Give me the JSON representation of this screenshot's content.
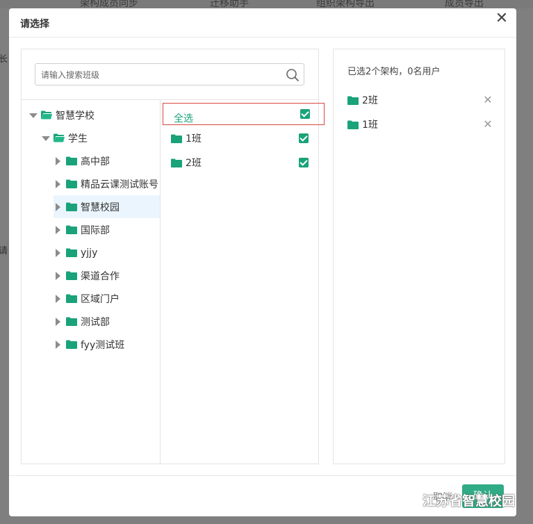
{
  "background": {
    "tabs": [
      "架构成员同步",
      "迁移助手",
      "组织架构导出",
      "成员导出"
    ],
    "left_chars": [
      "长",
      "请"
    ]
  },
  "modal": {
    "title": "请选择",
    "close_icon": "close-icon"
  },
  "search": {
    "placeholder": "请输入搜索班级",
    "icon": "search-icon"
  },
  "tree": {
    "root": {
      "label": "智慧学校",
      "expanded": true
    },
    "student": {
      "label": "学生",
      "expanded": true
    },
    "children": [
      {
        "label": "高中部",
        "selected": false
      },
      {
        "label": "精品云课测试账号",
        "selected": false
      },
      {
        "label": "智慧校园",
        "selected": true
      },
      {
        "label": "国际部",
        "selected": false
      },
      {
        "label": "yjjy",
        "selected": false
      },
      {
        "label": "渠道合作",
        "selected": false
      },
      {
        "label": "区域门户",
        "selected": false
      },
      {
        "label": "测试部",
        "selected": false
      },
      {
        "label": "fyy测试班",
        "selected": false
      }
    ]
  },
  "class_list": {
    "select_all_label": "全选",
    "select_all_checked": true,
    "items": [
      {
        "label": "1班",
        "checked": true
      },
      {
        "label": "2班",
        "checked": true
      }
    ]
  },
  "selected_panel": {
    "summary": "已选2个架构，0名用户",
    "items": [
      {
        "label": "2班"
      },
      {
        "label": "1班"
      }
    ]
  },
  "footer": {
    "cancel_label": "取消",
    "confirm_label": "确认"
  },
  "watermark": {
    "text": "江苏省智慧校园"
  },
  "colors": {
    "accent": "#1aa27a",
    "highlight_border": "#d9463e",
    "selected_row_bg": "#ebf5fd"
  }
}
